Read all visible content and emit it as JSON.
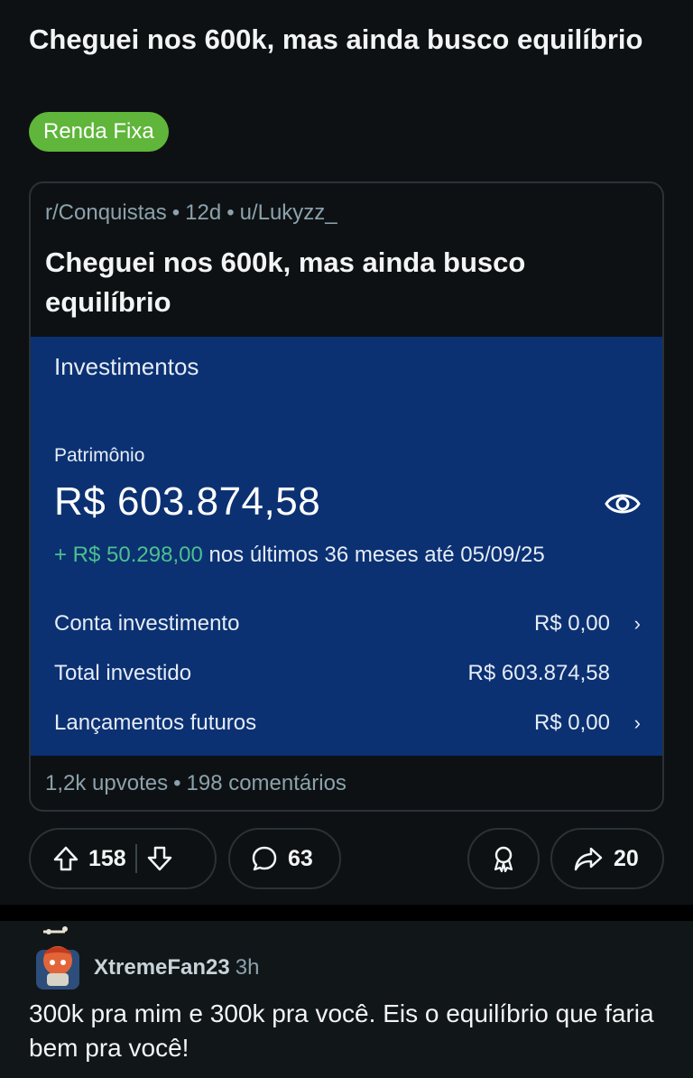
{
  "post": {
    "title": "Cheguei nos 600k, mas ainda busco equilíbrio",
    "flair": "Renda Fixa"
  },
  "crosspost": {
    "subreddit": "r/Conquistas",
    "age": "12d",
    "author": "u/Lukyzz_",
    "separator": "•",
    "title": "Cheguei nos 600k, mas ainda busco equilíbrio",
    "upvotes": "1,2k upvotes",
    "comments": "198 comentários"
  },
  "investments": {
    "heading": "Investimentos",
    "patrimonio_label": "Patrimônio",
    "patrimonio_value": "R$ 603.874,58",
    "gain_amount": "+ R$ 50.298,00",
    "gain_text": "nos últimos 36 meses até 05/09/25",
    "rows": [
      {
        "label": "Conta investimento",
        "value": "R$ 0,00",
        "chevron": "›"
      },
      {
        "label": "Total investido",
        "value": "R$ 603.874,58",
        "chevron": ""
      },
      {
        "label": "Lançamentos futuros",
        "value": "R$ 0,00",
        "chevron": "›"
      }
    ],
    "eye_icon": "eye-icon"
  },
  "actions": {
    "upvote_count": "158",
    "comment_count": "63",
    "share_count": "20",
    "icons": [
      "upvote-icon",
      "downvote-icon",
      "comment-icon",
      "award-icon",
      "share-icon"
    ]
  },
  "comment": {
    "author": "XtremeFan23",
    "time": "3h",
    "body": "300k pra mim e 300k pra você. Eis o equilíbrio que faria bem pra você!"
  },
  "colors": {
    "background": "#0e1113",
    "flair": "#5fb63a",
    "panel": "#0b3173",
    "gain": "#4cc08f"
  }
}
